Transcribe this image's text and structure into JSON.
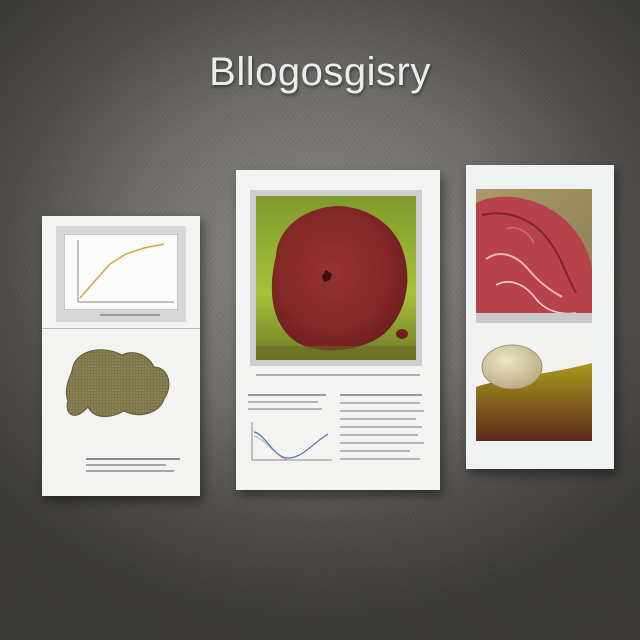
{
  "title": "Bllogosgisry",
  "colors": {
    "background": "#6f6d69",
    "poster_paper": "#f3f3f1",
    "cell_red": "#8b2b2b",
    "tissue_pink": "#b8424b",
    "organ_olive": "#7a7242",
    "seed_cream": "#d9cfa8",
    "leaf_green": "#9bb82c"
  },
  "posters": [
    {
      "id": "left",
      "icons": [
        "line-graph-icon",
        "organ-blob-icon"
      ]
    },
    {
      "id": "center",
      "icons": [
        "red-cell-icon",
        "curve-graph-icon"
      ]
    },
    {
      "id": "right",
      "icons": [
        "tissue-image-icon",
        "seed-image-icon"
      ]
    }
  ]
}
